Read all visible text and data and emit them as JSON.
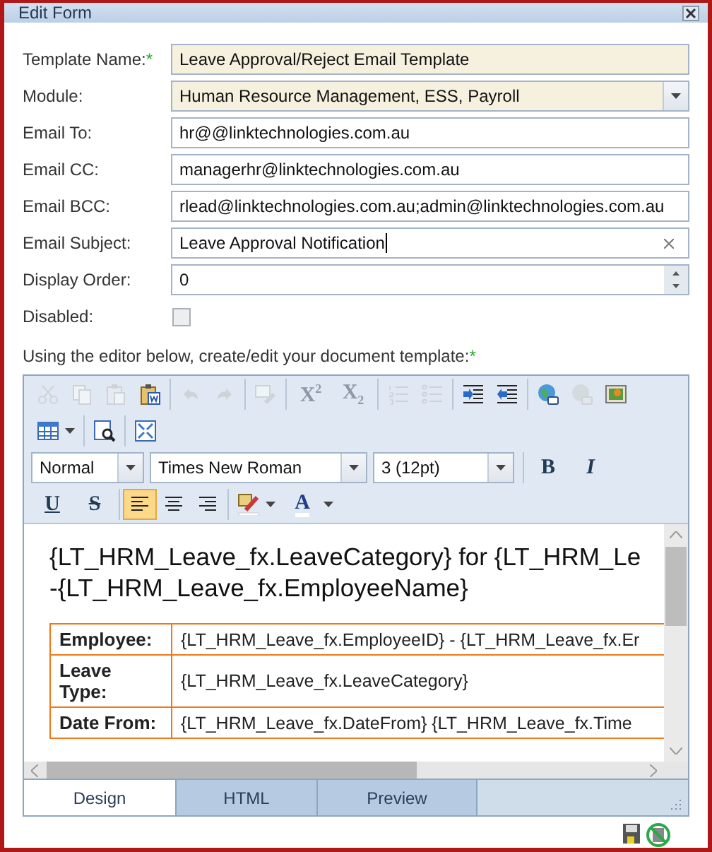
{
  "window": {
    "title": "Edit Form"
  },
  "fields": [
    {
      "label": "Template Name:",
      "mark": "*",
      "kind": "text",
      "value": "Leave Approval/Reject Email Template",
      "highlighted": true
    },
    {
      "label": "Module:",
      "kind": "dropdown",
      "value": "Human Resource Management, ESS, Payroll",
      "highlighted": true
    },
    {
      "label": "Email To:",
      "kind": "text",
      "value": "hr@@linktechnologies.com.au",
      "highlighted": false
    },
    {
      "label": "Email CC:",
      "kind": "text",
      "value": "managerhr@linktechnologies.com.au",
      "highlighted": false
    },
    {
      "label": "Email BCC:",
      "kind": "text",
      "value": "rlead@linktechnologies.com.au;admin@linktechnologies.com.au",
      "highlighted": false
    },
    {
      "label": "Email Subject:",
      "kind": "clearable",
      "value": "Leave Approval Notification",
      "highlighted": false,
      "focused": true
    },
    {
      "label": "Display Order:",
      "kind": "spinner",
      "value": "0",
      "highlighted": false
    },
    {
      "label": "Disabled:",
      "kind": "checkbox",
      "checked": false
    }
  ],
  "editor": {
    "instruction": "Using the editor below, create/edit your document template:",
    "mark": "*",
    "toolbar": [
      [
        [
          {
            "kind": "cut",
            "disabled": true
          },
          {
            "kind": "copy",
            "disabled": true
          },
          {
            "kind": "paste",
            "disabled": true
          },
          {
            "kind": "paste-word",
            "disabled": false
          }
        ],
        [
          {
            "kind": "undo",
            "disabled": true
          },
          {
            "kind": "redo",
            "disabled": true
          }
        ],
        [
          {
            "kind": "spell",
            "disabled": true
          }
        ],
        [
          {
            "kind": "superscript",
            "label": "X$^{2}$",
            "disabled": true
          },
          {
            "kind": "subscript",
            "label": "X$_{2}$",
            "disabled": true
          }
        ],
        [
          {
            "kind": "ol",
            "disabled": true
          },
          {
            "kind": "ul",
            "disabled": true
          }
        ],
        [
          {
            "kind": "indent",
            "disabled": false
          },
          {
            "kind": "outdent",
            "disabled": false
          }
        ],
        [
          {
            "kind": "link",
            "disabled": false
          },
          {
            "kind": "unlink",
            "disabled": true
          },
          {
            "kind": "image",
            "disabled": false
          }
        ]
      ],
      [
        [
          {
            "kind": "table",
            "disabled": false,
            "menu": true
          }
        ],
        [
          {
            "kind": "find",
            "disabled": false
          }
        ],
        [
          {
            "kind": "fullscreen",
            "disabled": false
          }
        ]
      ],
      [
        [
          {
            "kind": "dropdown",
            "value": "Normal"
          },
          {
            "kind": "dropdown",
            "value": "Times New Roman"
          },
          {
            "kind": "dropdown",
            "value": "3 (12pt)"
          }
        ],
        [
          {
            "kind": "bold",
            "label": "B",
            "disabled": false
          },
          {
            "kind": "italic",
            "label": "I",
            "disabled": false
          }
        ]
      ],
      [
        [
          {
            "kind": "underline",
            "label": "U",
            "disabled": false
          },
          {
            "kind": "strike",
            "label": "S",
            "disabled": false
          }
        ],
        [
          {
            "kind": "align-left",
            "disabled": false,
            "selected": true
          },
          {
            "kind": "align-center",
            "disabled": false,
            "selected": false
          },
          {
            "kind": "align-right",
            "disabled": false,
            "selected": false
          }
        ],
        [
          {
            "kind": "highlight",
            "disabled": false,
            "menu": true
          },
          {
            "kind": "font-color",
            "label": "A",
            "disabled": false,
            "menu": true
          }
        ]
      ]
    ],
    "heading_lines": [
      "{LT_HRM_Leave_fx.LeaveCategory} for {LT_HRM_Le",
      "-{LT_HRM_Leave_fx.EmployeeName}"
    ],
    "table": {
      "rows": [
        {
          "label": "Employee:",
          "value": "{LT_HRM_Leave_fx.EmployeeID} - {LT_HRM_Leave_fx.Er"
        },
        {
          "label": "Leave Type:",
          "value": "{LT_HRM_Leave_fx.LeaveCategory}"
        },
        {
          "label": "Date From:",
          "value": "{LT_HRM_Leave_fx.DateFrom} {LT_HRM_Leave_fx.Time"
        }
      ]
    },
    "tabs": [
      {
        "label": "Design",
        "selected": true
      },
      {
        "label": "HTML",
        "selected": false
      },
      {
        "label": "Preview",
        "selected": false
      }
    ]
  }
}
